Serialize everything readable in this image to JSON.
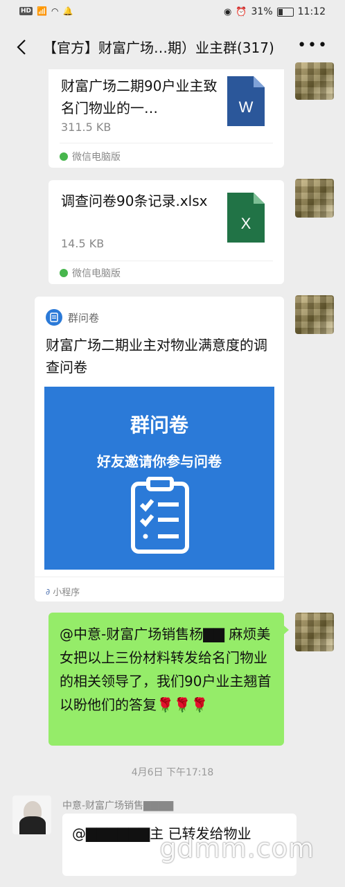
{
  "status": {
    "left_icons": [
      "hd-icon",
      "4g-icon",
      "signal-icon",
      "wifi-icon",
      "notification-icon"
    ],
    "battery": "31%",
    "time": "11:12"
  },
  "header": {
    "title": "【官方】财富广场…期）业主群(317)"
  },
  "messages": {
    "file1": {
      "name": "财富广场二期90户业主致名门物业的一…",
      "size": "311.5 KB",
      "source": "微信电脑版",
      "icon": "word-doc-icon",
      "icon_letter": "W"
    },
    "file2": {
      "name": "调查问卷90条记录.xlsx",
      "size": "14.5 KB",
      "source": "微信电脑版",
      "icon": "excel-doc-icon",
      "icon_letter": "X"
    },
    "miniprogram": {
      "app_name": "群问卷",
      "title": "财富广场二期业主对物业满意度的调查问卷",
      "banner_title": "群问卷",
      "banner_subtitle": "好友邀请你参与问卷",
      "footer": "小程序"
    },
    "text1": "@中意-财富广场销售杨▇▇ 麻烦美女把以上三份材料转发给名门物业的相关领导了，我们90户业主翘首以盼他们的答复🌹🌹🌹",
    "timestamp": "4月6日 下午17:18",
    "reply": {
      "sender": "中意-财富广场销售▇▇▇▇",
      "text": "@▇▇▇▇▇▇主 已转发给物业"
    }
  },
  "watermark": "gdmm.com",
  "colors": {
    "bubble_green": "#95ec69",
    "background": "#ededed",
    "word_blue": "#2b579a",
    "excel_green": "#217346",
    "banner_blue": "#2b7ad8"
  }
}
